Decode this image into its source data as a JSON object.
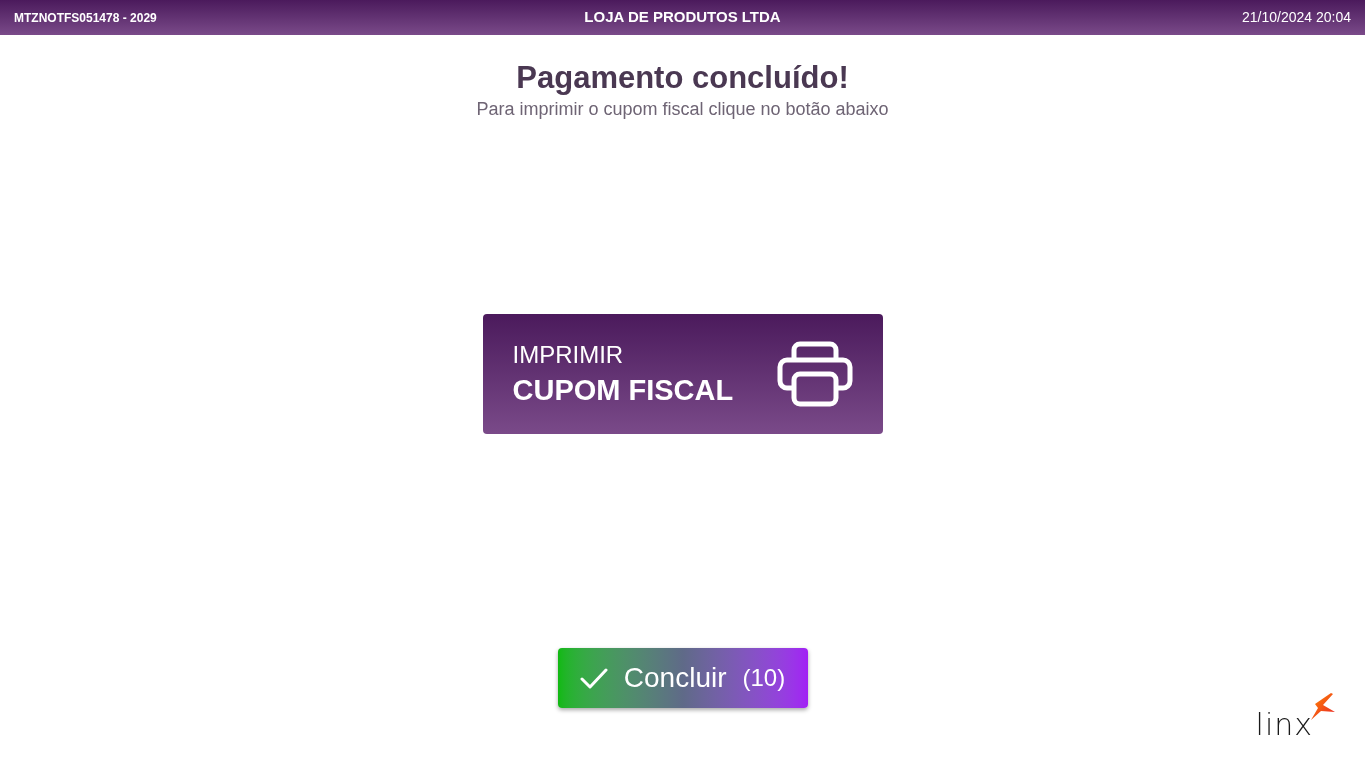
{
  "header": {
    "terminal": "MTZNOTFS051478 - 2029",
    "store_name": "LOJA DE PRODUTOS LTDA",
    "datetime": "21/10/2024 20:04"
  },
  "title": "Pagamento concluído!",
  "subtitle": "Para imprimir o cupom fiscal clique no botão abaixo",
  "print_button": {
    "line_1": "IMPRIMIR",
    "line_2": "CUPOM FISCAL"
  },
  "finish_button": {
    "label": "Concluir",
    "countdown": "(10)"
  },
  "logo": {
    "text": "linx"
  }
}
